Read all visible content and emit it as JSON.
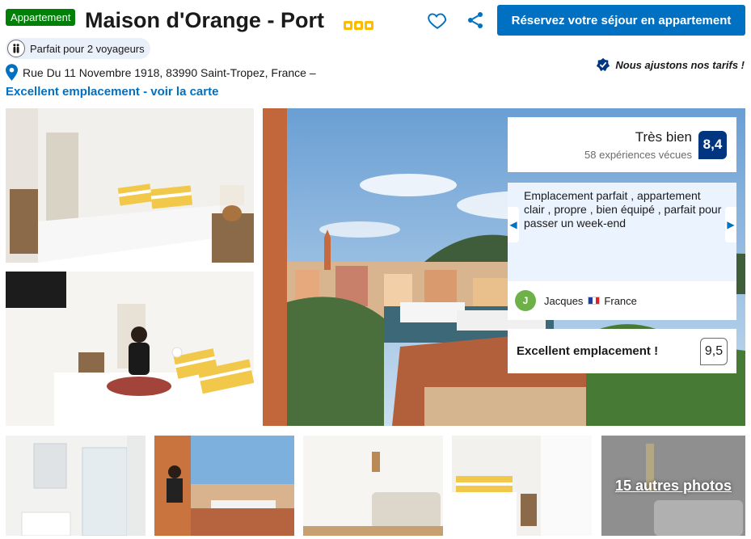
{
  "header": {
    "property_type_badge": "Appartement",
    "title": "Maison d'Orange - Port",
    "stars": 3,
    "reserve_button": "Réservez votre séjour en appartement",
    "travellers_label": "Parfait pour 2 voyageurs",
    "price_guarantee": "Nous ajustons nos tarifs !",
    "address": "Rue Du 11 Novembre 1918, 83990 Saint-Tropez, France –",
    "location_link": "Excellent emplacement - voir la carte"
  },
  "review_panel": {
    "rating_word": "Très bien",
    "rating_count": "58 expériences vécues",
    "rating_score": "8,4",
    "quote": "Emplacement parfait , appartement clair , propre , bien équipé , parfait pour passer un week-end",
    "reviewer_initial": "J",
    "reviewer_name": "Jacques",
    "reviewer_country": "France",
    "sub_score_label": "Excellent emplacement !",
    "sub_score_value": "9,5"
  },
  "gallery": {
    "more_photos_label": "15 autres photos"
  },
  "colors": {
    "brand_blue": "#0071c2",
    "dark_blue": "#003580",
    "green_badge": "#008009",
    "star_yellow": "#febb02"
  }
}
